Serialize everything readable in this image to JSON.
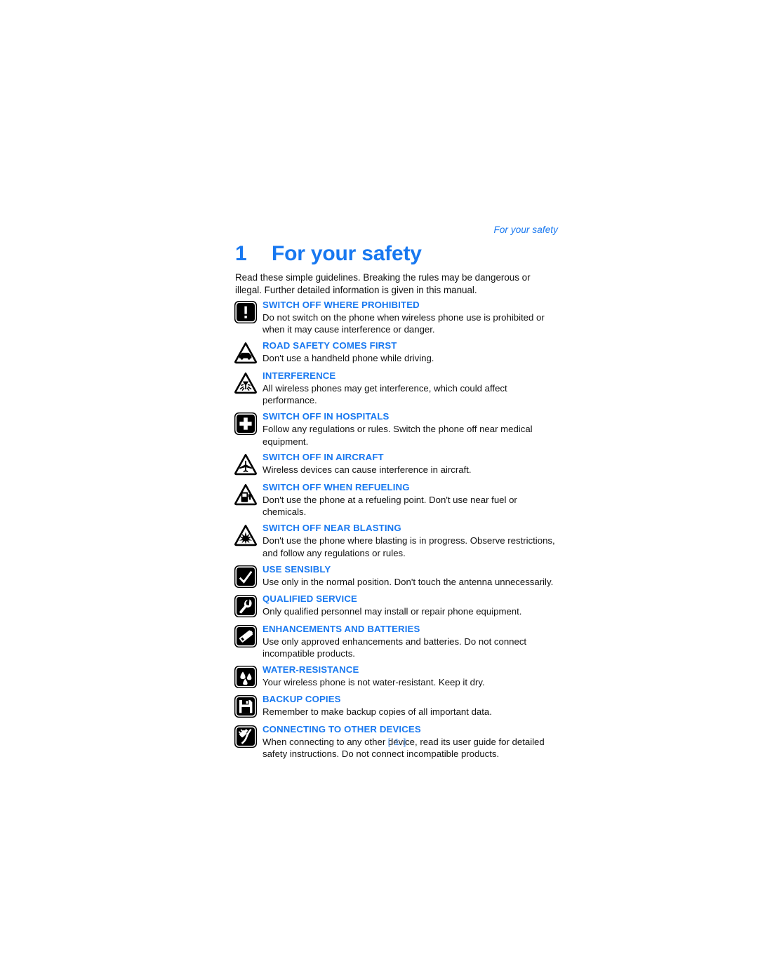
{
  "header": {
    "running_head": "For your safety"
  },
  "chapter": {
    "number": "1",
    "title": "For your safety"
  },
  "intro": {
    "text": "Read these simple guidelines. Breaking the rules may be dangerous or illegal. Further detailed information is given in this manual."
  },
  "footer": {
    "page_number": "[ 1 ]"
  },
  "colors": {
    "accent_blue": "#1878f0",
    "footer_blue": "#4a90e8",
    "body_text": "#111111",
    "icon_black": "#000000",
    "page_background": "#ffffff"
  },
  "safety_items": [
    {
      "icon": "exclamation-square-icon",
      "icon_shape": "square",
      "title": "SWITCH OFF WHERE PROHIBITED",
      "description": "Do not switch on the phone when wireless phone use is prohibited or when it may cause interference or danger."
    },
    {
      "icon": "car-triangle-icon",
      "icon_shape": "triangle",
      "title": "ROAD SAFETY COMES FIRST",
      "description": "Don't use a handheld phone while driving."
    },
    {
      "icon": "interference-triangle-icon",
      "icon_shape": "triangle",
      "title": "INTERFERENCE",
      "description": "All wireless phones may get interference, which could affect performance."
    },
    {
      "icon": "hospital-cross-square-icon",
      "icon_shape": "square",
      "title": "SWITCH OFF IN HOSPITALS",
      "description": "Follow any regulations or rules. Switch the phone off near medical equipment."
    },
    {
      "icon": "airplane-triangle-icon",
      "icon_shape": "triangle",
      "title": "SWITCH OFF IN AIRCRAFT",
      "description": "Wireless devices can cause interference in aircraft."
    },
    {
      "icon": "fuel-pump-triangle-icon",
      "icon_shape": "triangle",
      "title": "SWITCH OFF WHEN REFUELING",
      "description": "Don't use the phone at a refueling point. Don't use near fuel or chemicals."
    },
    {
      "icon": "blasting-triangle-icon",
      "icon_shape": "triangle",
      "title": "SWITCH OFF NEAR BLASTING",
      "description": "Don't use the phone where blasting is in progress. Observe restrictions, and follow any regulations or rules."
    },
    {
      "icon": "checkmark-square-icon",
      "icon_shape": "square",
      "title": "USE SENSIBLY",
      "description": "Use only in the normal position. Don't touch the antenna unnecessarily."
    },
    {
      "icon": "wrench-square-icon",
      "icon_shape": "square",
      "title": "QUALIFIED SERVICE",
      "description": "Only qualified personnel may install or repair phone equipment."
    },
    {
      "icon": "battery-square-icon",
      "icon_shape": "square",
      "title": "ENHANCEMENTS AND BATTERIES",
      "description": "Use only approved enhancements and batteries. Do not connect incompatible products."
    },
    {
      "icon": "water-drops-square-icon",
      "icon_shape": "square",
      "title": "WATER-RESISTANCE",
      "description": "Your wireless phone is not water-resistant. Keep it dry."
    },
    {
      "icon": "floppy-disk-square-icon",
      "icon_shape": "square",
      "title": "BACKUP COPIES",
      "description": "Remember to make backup copies of all important data."
    },
    {
      "icon": "connector-plug-square-icon",
      "icon_shape": "square",
      "title": "CONNECTING TO OTHER DEVICES",
      "description": "When connecting to any other device, read its user guide for detailed safety instructions. Do not connect incompatible products."
    }
  ]
}
